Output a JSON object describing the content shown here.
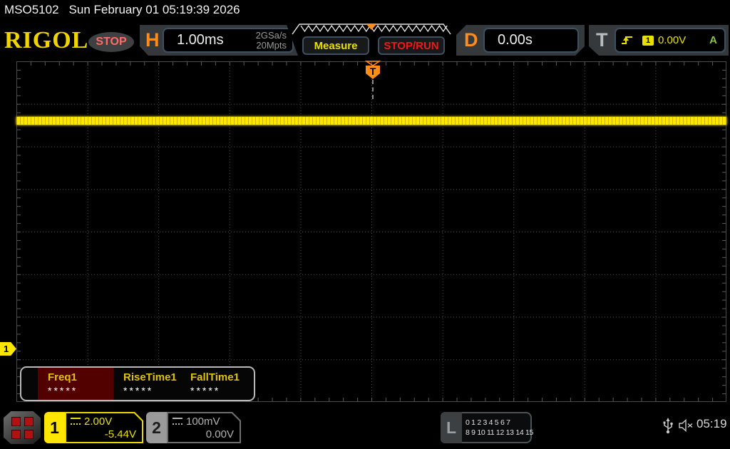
{
  "titlebar": {
    "model": "MSO5102",
    "datetime": "Sun February 01 05:19:39 2026"
  },
  "header": {
    "brand": "RIGOL",
    "acq_state": "STOP",
    "horizontal": {
      "key": "H",
      "timebase": "1.00ms",
      "sample_rate": "2GSa/s",
      "memory_depth": "20Mpts"
    },
    "buttons": {
      "measure": "Measure",
      "stop_run": "STOP/RUN"
    },
    "delay": {
      "key": "D",
      "value": "0.00s"
    },
    "trigger": {
      "key": "T",
      "source": "1",
      "level": "0.00V",
      "mode": "A"
    }
  },
  "display": {
    "trigger_marker": "T",
    "ch1_marker": "1"
  },
  "measurements": {
    "items": [
      {
        "label": "Freq1",
        "value": "*****"
      },
      {
        "label": "RiseTime1",
        "value": "*****"
      },
      {
        "label": "FallTime1",
        "value": "*****"
      }
    ]
  },
  "statusbar": {
    "ch1": {
      "num": "1",
      "scale": "2.00V",
      "offset": "-5.44V"
    },
    "ch2": {
      "num": "2",
      "scale": "100mV",
      "offset": "0.00V"
    },
    "logic": {
      "key": "L",
      "row1": "0 1 2 3   4 5 6 7",
      "row2": "8 9 10 11 12 13 14 15"
    },
    "time": "05:19"
  },
  "colors": {
    "trace": "#ffe600",
    "ch1": "#ffe600",
    "ch2": "#9a9a9a",
    "orange": "#ff8c1a",
    "stop_text": "#ff6b66",
    "run_red": "#f01818",
    "trig_yellow": "#e8e000",
    "mode_green": "#8cc63f",
    "brand_yellow": "#f0d400",
    "grid": "#4f4f4f"
  }
}
